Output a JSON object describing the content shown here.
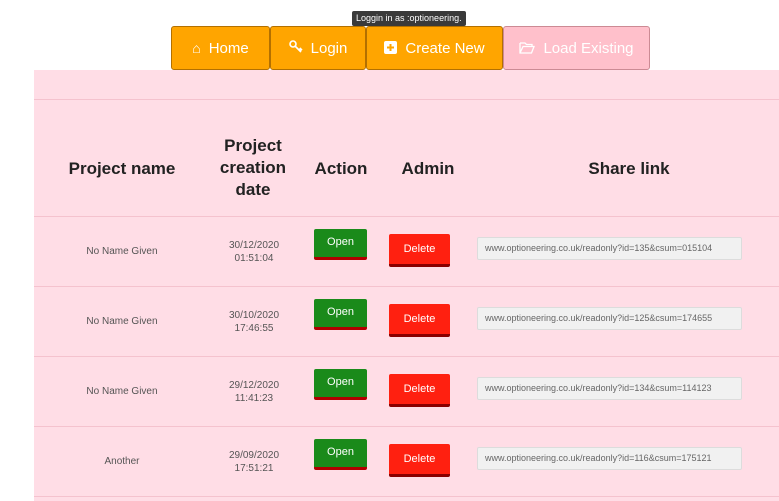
{
  "tooltip": "Loggin in as :optioneering.",
  "nav": {
    "home": "Home",
    "login": "Login",
    "create": "Create New",
    "load": "Load Existing"
  },
  "icons": {
    "home": "home-icon",
    "login": "key-icon",
    "create": "plus-square-icon",
    "load": "folder-open-icon"
  },
  "colors": {
    "nav_active": "#ffa500",
    "nav_disabled": "#ffc0cb",
    "panel_bg": "#ffdde6",
    "open_button": "#1a8a1a",
    "delete_button": "#ff2010"
  },
  "table": {
    "headers": {
      "name": "Project name",
      "date_line1": "Project",
      "date_line2": "creation",
      "date_line3": "date",
      "action": "Action",
      "admin": "Admin",
      "share": "Share link"
    },
    "open_label": "Open",
    "delete_label": "Delete",
    "rows": [
      {
        "name": "No Name Given",
        "date": "30/12/2020",
        "time": "01:51:04",
        "link": "www.optioneering.co.uk/readonly?id=135&csum=015104"
      },
      {
        "name": "No Name Given",
        "date": "30/10/2020",
        "time": "17:46:55",
        "link": "www.optioneering.co.uk/readonly?id=125&csum=174655"
      },
      {
        "name": "No Name Given",
        "date": "29/12/2020",
        "time": "11:41:23",
        "link": "www.optioneering.co.uk/readonly?id=134&csum=114123"
      },
      {
        "name": "Another",
        "date": "29/09/2020",
        "time": "17:51:21",
        "link": "www.optioneering.co.uk/readonly?id=116&csum=175121"
      }
    ]
  }
}
